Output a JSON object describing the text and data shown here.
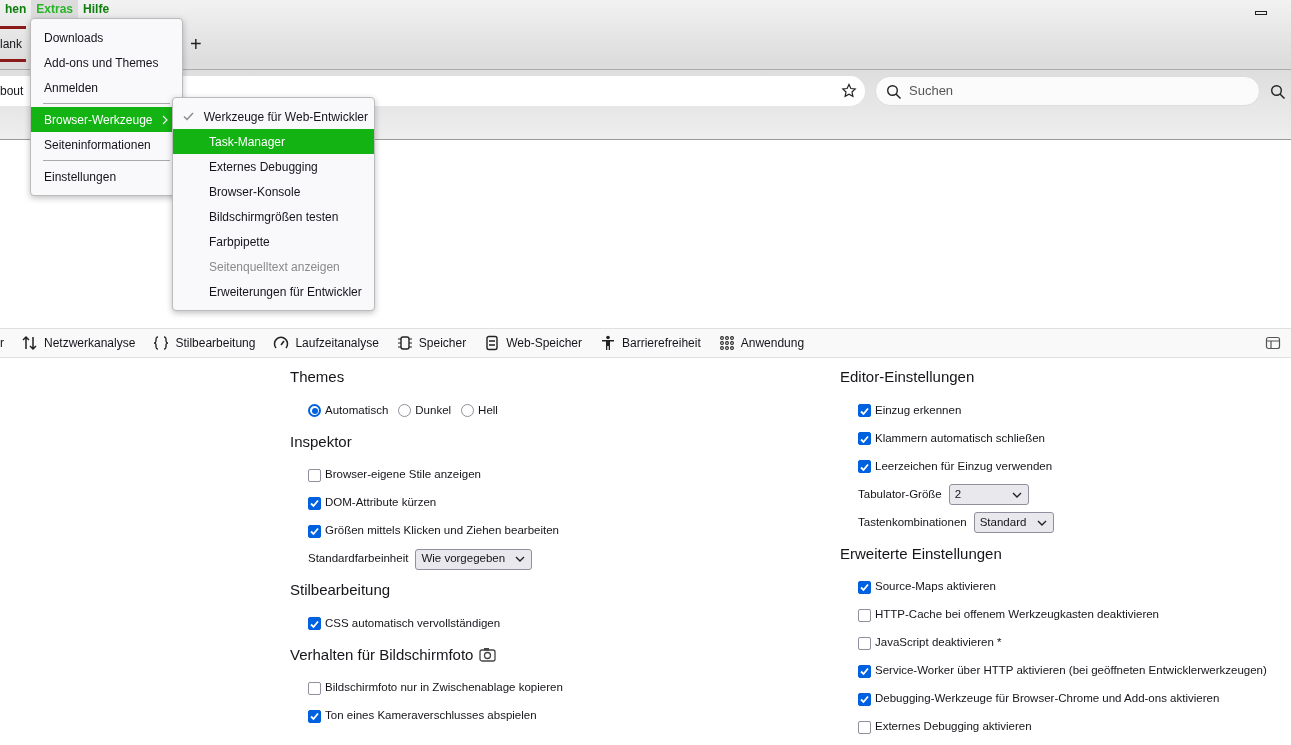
{
  "browser": {
    "menubar": [
      {
        "label": "hen",
        "selected": false
      },
      {
        "label": "Extras",
        "selected": true
      },
      {
        "label": "Hilfe",
        "selected": false
      }
    ],
    "tab": {
      "label": "lank"
    },
    "new_tab_button": "+",
    "url_field": {
      "value": "bout"
    },
    "search_field": {
      "placeholder": "Suchen"
    }
  },
  "extras_menu": [
    {
      "kind": "item",
      "label": "Downloads",
      "selected": false,
      "submenu": false
    },
    {
      "kind": "item",
      "label": "Add-ons und Themes",
      "selected": false,
      "submenu": false
    },
    {
      "kind": "item",
      "label": "Anmelden",
      "selected": false,
      "submenu": false
    },
    {
      "kind": "separator"
    },
    {
      "kind": "item",
      "label": "Browser-Werkzeuge",
      "selected": true,
      "submenu": true
    },
    {
      "kind": "item",
      "label": "Seiteninformationen",
      "selected": false,
      "submenu": false
    },
    {
      "kind": "separator"
    },
    {
      "kind": "item",
      "label": "Einstellungen",
      "selected": false,
      "submenu": false
    }
  ],
  "tools_submenu": [
    {
      "label": "Werkzeuge für Web-Entwickler",
      "checked": true,
      "selected": false,
      "disabled": false
    },
    {
      "label": "Task-Manager",
      "checked": false,
      "selected": true,
      "disabled": false
    },
    {
      "label": "Externes Debugging",
      "checked": false,
      "selected": false,
      "disabled": false
    },
    {
      "label": "Browser-Konsole",
      "checked": false,
      "selected": false,
      "disabled": false
    },
    {
      "label": "Bildschirmgrößen testen",
      "checked": false,
      "selected": false,
      "disabled": false
    },
    {
      "label": "Farbpipette",
      "checked": false,
      "selected": false,
      "disabled": false
    },
    {
      "label": "Seitenquelltext anzeigen",
      "checked": false,
      "selected": false,
      "disabled": true
    },
    {
      "label": "Erweiterungen für Entwickler",
      "checked": false,
      "selected": false,
      "disabled": false
    }
  ],
  "devtools_tabs": [
    {
      "label": "r"
    },
    {
      "label": "Netzwerkanalyse"
    },
    {
      "label": "Stilbearbeitung"
    },
    {
      "label": "Laufzeitanalyse"
    },
    {
      "label": "Speicher"
    },
    {
      "label": "Web-Speicher"
    },
    {
      "label": "Barrierefreiheit"
    },
    {
      "label": "Anwendung"
    }
  ],
  "settings": {
    "columns": [
      [
        {
          "heading": "Themes",
          "items": [
            {
              "kind": "radio-group",
              "options": [
                {
                  "label": "Automatisch",
                  "selected": true
                },
                {
                  "label": "Dunkel",
                  "selected": false
                },
                {
                  "label": "Hell",
                  "selected": false
                }
              ]
            }
          ]
        },
        {
          "heading": "Inspektor",
          "items": [
            {
              "kind": "checkbox",
              "label": "Browser-eigene Stile anzeigen",
              "checked": false
            },
            {
              "kind": "checkbox",
              "label": "DOM-Attribute kürzen",
              "checked": true
            },
            {
              "kind": "checkbox",
              "label": "Größen mittels Klicken und Ziehen bearbeiten",
              "checked": true
            },
            {
              "kind": "select",
              "label": "Standardfarbeinheit",
              "value": "Wie vorgegeben"
            }
          ]
        },
        {
          "heading": "Stilbearbeitung",
          "items": [
            {
              "kind": "checkbox",
              "label": "CSS automatisch vervollständigen",
              "checked": true
            }
          ]
        },
        {
          "heading": "Verhalten für Bildschirmfoto",
          "items": [
            {
              "kind": "checkbox",
              "label": "Bildschirmfoto nur in Zwischenablage kopieren",
              "checked": false
            },
            {
              "kind": "checkbox",
              "label": "Ton eines Kameraverschlusses abspielen",
              "checked": true
            }
          ]
        }
      ],
      [
        {
          "heading": "Editor-Einstellungen",
          "items": [
            {
              "kind": "checkbox",
              "label": "Einzug erkennen",
              "checked": true
            },
            {
              "kind": "checkbox",
              "label": "Klammern automatisch schließen",
              "checked": true
            },
            {
              "kind": "checkbox",
              "label": "Leerzeichen für Einzug verwenden",
              "checked": true
            },
            {
              "kind": "select",
              "label": "Tabulator-Größe",
              "value": "2"
            },
            {
              "kind": "select",
              "label": "Tastenkombinationen",
              "value": "Standard"
            }
          ]
        },
        {
          "heading": "Erweiterte Einstellungen",
          "items": [
            {
              "kind": "checkbox",
              "label": "Source-Maps aktivieren",
              "checked": true
            },
            {
              "kind": "checkbox",
              "label": "HTTP-Cache bei offenem Werkzeugkasten deaktivieren",
              "checked": false
            },
            {
              "kind": "checkbox",
              "label": "JavaScript deaktivieren *",
              "checked": false
            },
            {
              "kind": "checkbox",
              "label": "Service-Worker über HTTP aktivieren (bei geöffneten Entwicklerwerkzeugen)",
              "checked": true
            },
            {
              "kind": "checkbox",
              "label": "Debugging-Werkzeuge für Browser-Chrome und Add-ons aktivieren",
              "checked": true
            },
            {
              "kind": "checkbox",
              "label": "Externes Debugging aktivieren",
              "checked": false
            }
          ]
        }
      ]
    ]
  }
}
